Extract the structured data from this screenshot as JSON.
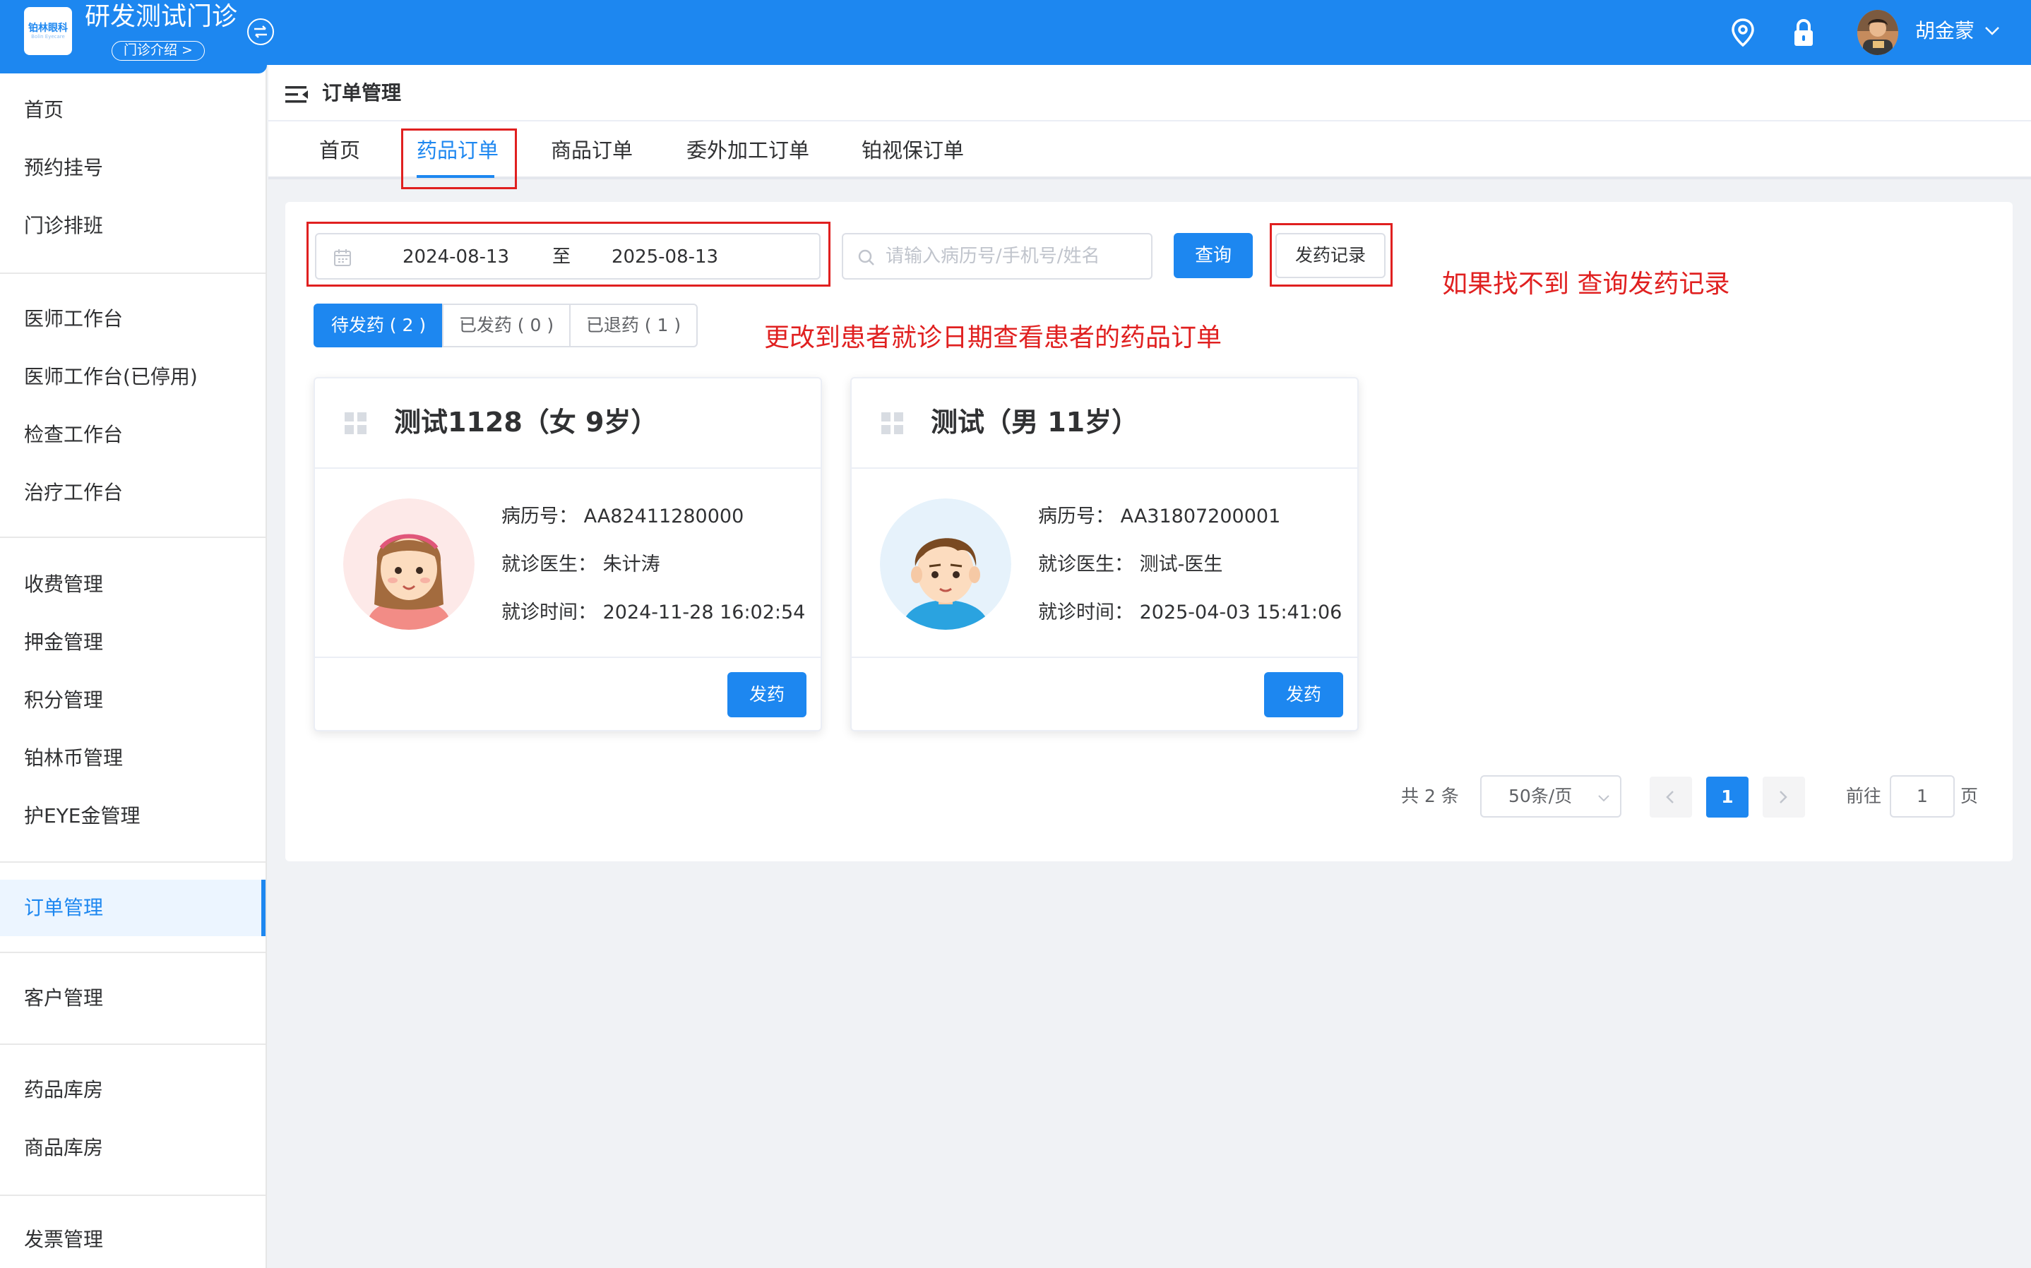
{
  "header": {
    "logo_text": "铂林眼科",
    "logo_sub": "Bolin Eyecare",
    "clinic_name": "研发测试门诊",
    "clinic_intro": "门诊介绍 >",
    "user_name": "胡金蒙",
    "accent_color": "#1d87f0",
    "icons": [
      "switch-icon",
      "location-icon",
      "lock-icon",
      "chevron-down-icon"
    ]
  },
  "sidebar": {
    "items": [
      {
        "label": "首页"
      },
      {
        "label": "预约挂号"
      },
      {
        "label": "门诊排班"
      },
      {
        "label": "医师工作台"
      },
      {
        "label": "医师工作台(已停用)"
      },
      {
        "label": "检查工作台"
      },
      {
        "label": "治疗工作台"
      },
      {
        "label": "收费管理"
      },
      {
        "label": "押金管理"
      },
      {
        "label": "积分管理"
      },
      {
        "label": "铂林币管理"
      },
      {
        "label": "护EYE金管理"
      },
      {
        "label": "订单管理"
      },
      {
        "label": "客户管理"
      },
      {
        "label": "药品库房"
      },
      {
        "label": "商品库房"
      },
      {
        "label": "发票管理"
      }
    ],
    "active": "订单管理"
  },
  "page": {
    "title": "订单管理",
    "tabs": [
      {
        "label": "首页"
      },
      {
        "label": "药品订单"
      },
      {
        "label": "商品订单"
      },
      {
        "label": "委外加工订单"
      },
      {
        "label": "铂视保订单"
      }
    ],
    "active_tab": "药品订单"
  },
  "filters": {
    "date_start": "2024-08-13",
    "date_separator": "至",
    "date_end": "2025-08-13",
    "search_placeholder": "请输入病历号/手机号/姓名",
    "search_value": "",
    "query_button": "查询",
    "record_button": "发药记录"
  },
  "status_tabs": [
    {
      "label": "待发药 ( 2 )"
    },
    {
      "label": "已发药 ( 0 )"
    },
    {
      "label": "已退药 ( 1 )"
    }
  ],
  "active_status": "待发药 ( 2 )",
  "annotations": {
    "record_hint": "如果找不到 查询发药记录",
    "date_hint": "更改到患者就诊日期查看患者的药品订单",
    "annotation_color": "#e02020"
  },
  "cards": [
    {
      "title": "测试1128（女 9岁）",
      "record_label": "病历号：",
      "record_no": "AA82411280000",
      "doctor_label": "就诊医生：",
      "doctor": "朱计涛",
      "time_label": "就诊时间：",
      "time": "2024-11-28 16:02:54",
      "avatar": "girl-avatar",
      "action": "发药"
    },
    {
      "title": "测试（男 11岁）",
      "record_label": "病历号：",
      "record_no": "AA31807200001",
      "doctor_label": "就诊医生：",
      "doctor": "测试-医生",
      "time_label": "就诊时间：",
      "time": "2025-04-03 15:41:06",
      "avatar": "boy-avatar",
      "action": "发药"
    }
  ],
  "pagination": {
    "total": "共 2 条",
    "page_size": "50条/页",
    "current_page": "1",
    "goto_label": "前往",
    "goto_value": "1",
    "page_suffix": "页"
  }
}
